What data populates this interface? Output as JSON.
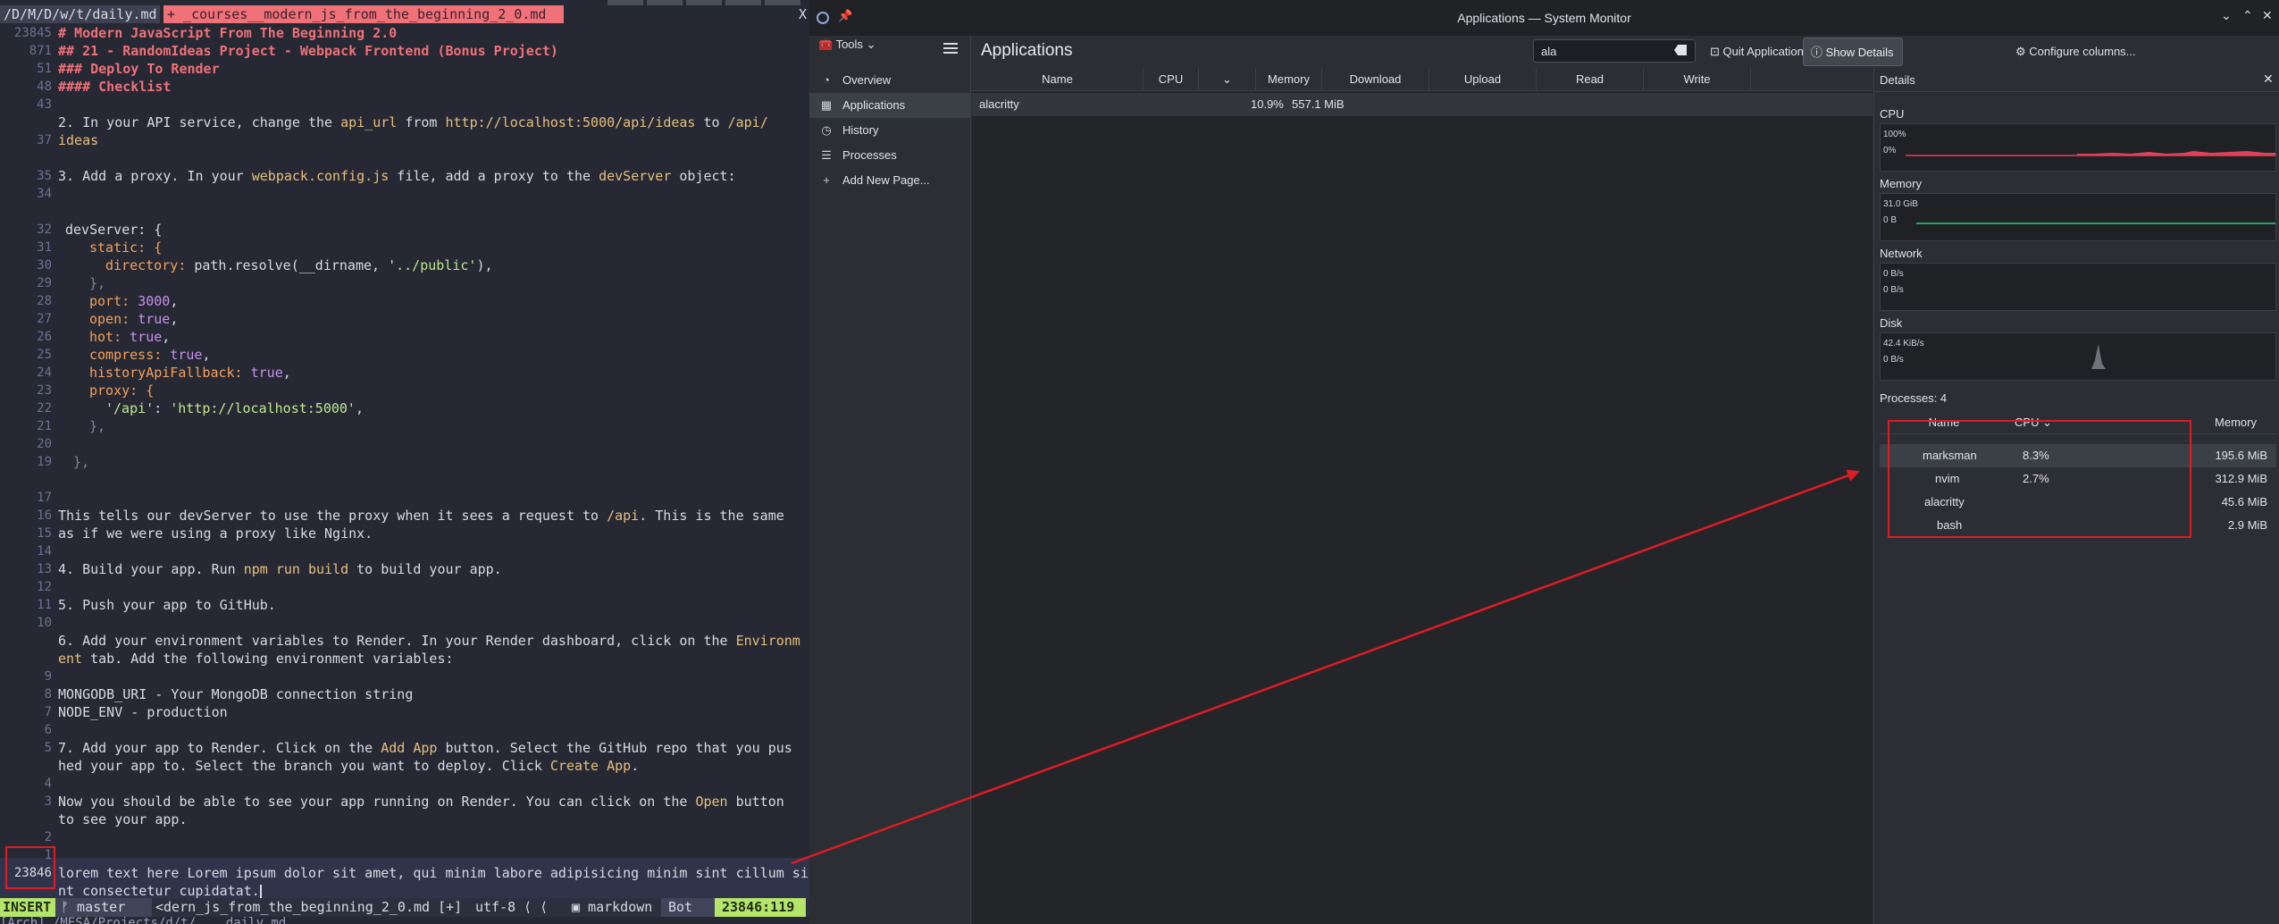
{
  "editor": {
    "tabs": {
      "daily": "/D/M/D/w/t/daily.md",
      "course": " +  _courses__modern_js_from_the_beginning_2_0.md",
      "close": "X"
    },
    "gutter": [
      "23845",
      "871",
      "51",
      "48",
      "43",
      "",
      "37",
      "",
      "35",
      "34",
      "",
      "32",
      "31",
      "30",
      "29",
      "28",
      "27",
      "26",
      "25",
      "24",
      "23",
      "22",
      "21",
      "20",
      "19",
      "",
      "17",
      "16",
      "15",
      "14",
      "13",
      "12",
      "11",
      "10",
      "9",
      "8",
      "7",
      "6",
      "5",
      "4",
      "3",
      "2",
      "1",
      "23846",
      ""
    ],
    "lines": {
      "h1": "# Modern JavaScript From The Beginning 2.0",
      "h2": "## 21 - RandomIdeas Project - Webpack Frontend (Bonus Project)",
      "h3": "### Deploy To Render",
      "h4": "#### Checklist",
      "l37a": "2. In your API service, change the ",
      "l37b": "api_url",
      "l37c": " from ",
      "l37d": "http://localhost:5000/api/ideas",
      "l37e": " to ",
      "l37f": "/api/",
      "l37g": "ideas",
      "l35a": "3. Add a proxy. In your ",
      "l35b": "webpack.config.js",
      "l35c": " file, add a proxy to the ",
      "l35d": "devServer",
      "l35e": " object:",
      "c1": "devServer: {",
      "c2k": "static: {",
      "c3k": "directory: ",
      "c3v": "path.resolve(__dirname, ",
      "c3s": "'../public'",
      "c3e": "),",
      "c4": "},",
      "c5k": "port: ",
      "c5v": "3000",
      "c6k": "open: ",
      "c6v": "true",
      "c7k": "hot: ",
      "c7v": "true",
      "c8k": "compress: ",
      "c8v": "true",
      "c9k": "historyApiFallback: ",
      "c9v": "true",
      "c10k": "proxy: {",
      "c11k": "'/api'",
      "c11s": "'http://localhost:5000'",
      "c12": "},",
      "c13": "},",
      "p1a": "This tells our devServer to use the proxy when it sees a request to ",
      "p1b": "/api",
      "p1c": ". This is the same",
      "p1d": "as if we were using a proxy like Nginx.",
      "p4a": "4. Build your app. Run ",
      "p4b": "npm run build",
      "p4c": " to build your app.",
      "p5": "5. Push your app to GitHub.",
      "p6a": "6. Add your environment variables to Render. In your Render dashboard, click on the ",
      "p6b": "Environm",
      "p6c": "ent",
      "p6d": " tab. Add the following environment variables:",
      "env1": "MONGODB_URI - Your MongoDB connection string",
      "env2": "NODE_ENV - production",
      "p7a": "7. Add your app to Render. Click on the ",
      "p7b": "Add App",
      "p7c": " button. Select the GitHub repo that you pus",
      "p7d": "hed your app to. Select the branch you want to deploy. Click ",
      "p7e": "Create App",
      "p7f": ".",
      "p8a": "Now you should be able to see your app running on Render. You can click on the ",
      "p8b": "Open",
      "p8c": " button",
      "p8d": "to see your app.",
      "lorem1": "lorem text here Lorem ipsum dolor sit amet, qui minim labore adipisicing minim sint cillum si",
      "lorem2": "nt consectetur cupidatat."
    },
    "status": {
      "mode": "INSERT",
      "branch": " master",
      "file": "<dern_js_from_the_beginning_2_0.md [+]",
      "encoding": "utf-8 ⟨ ⟨",
      "filetype": "markdown",
      "position": "Bot",
      "linecol": "23846:119"
    },
    "cmdline": "[Arch] /MESA/Projects/d/t/... daily.md ..."
  },
  "sysmon": {
    "window_title": "Applications — System Monitor",
    "tools_label": "Tools",
    "nav": [
      {
        "label": "Overview",
        "icon": "gauge-icon"
      },
      {
        "label": "Applications",
        "icon": "grid-icon"
      },
      {
        "label": "History",
        "icon": "history-icon"
      },
      {
        "label": "Processes",
        "icon": "list-icon"
      },
      {
        "label": "Add New Page...",
        "icon": "plus-icon"
      }
    ],
    "page_title": "Applications",
    "search_value": "ala",
    "quit_label": "Quit Application",
    "details_label": "Show Details Sidebar",
    "configure_label": "Configure columns...",
    "columns": [
      "Name",
      "CPU",
      "Memory",
      "Download",
      "Upload",
      "Read",
      "Write"
    ],
    "app_row": {
      "name": "alacritty",
      "cpu": "10.9%",
      "memory": "557.1 MiB"
    },
    "details": {
      "title": "Details",
      "cpu": {
        "label": "CPU",
        "max": "100%",
        "min": "0%"
      },
      "memory": {
        "label": "Memory",
        "max": "31.0 GiB",
        "min": "0 B"
      },
      "network": {
        "label": "Network",
        "max": "0 B/s",
        "min": "0 B/s"
      },
      "disk": {
        "label": "Disk",
        "max": "42.4 KiB/s",
        "min": "0 B/s"
      },
      "processes_count": "Processes: 4",
      "proc_columns": [
        "Name",
        "CPU",
        "Memory"
      ],
      "processes": [
        {
          "name": "marksman",
          "cpu": "8.3%",
          "memory": "195.6 MiB"
        },
        {
          "name": "nvim",
          "cpu": "2.7%",
          "memory": "312.9 MiB"
        },
        {
          "name": "alacritty",
          "cpu": "",
          "memory": "45.6 MiB"
        },
        {
          "name": "bash",
          "cpu": "",
          "memory": "2.9 MiB"
        }
      ]
    }
  },
  "colors": {
    "annotation": "#e01b24",
    "heading": "#f07178",
    "insert_mode": "#b5e46b"
  }
}
